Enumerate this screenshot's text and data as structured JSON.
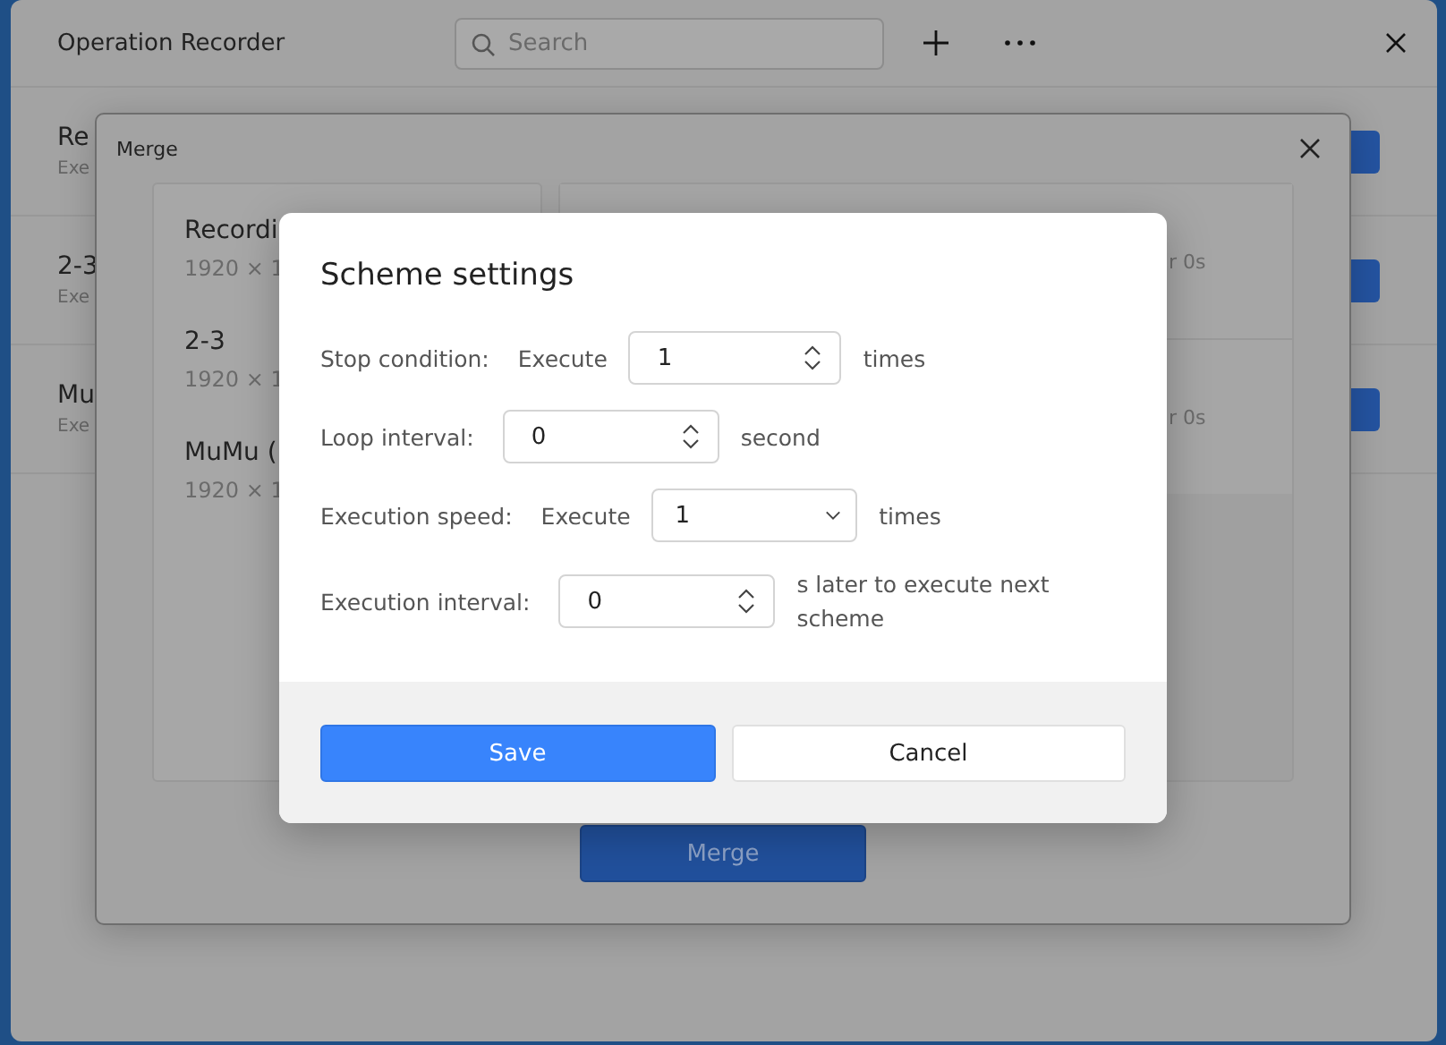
{
  "main_window": {
    "title": "Operation Recorder",
    "search": {
      "placeholder": "Search"
    },
    "rows": [
      {
        "name": "Re",
        "detail": "Exe"
      },
      {
        "name": "2-3",
        "detail": "Exe"
      },
      {
        "name": "Mu",
        "detail": "Exe"
      }
    ]
  },
  "merge_dialog": {
    "title": "Merge",
    "recordings": [
      {
        "name": "Recordi",
        "resolution": "1920 × 1"
      },
      {
        "name": "2-3",
        "resolution": "1920 × 1"
      },
      {
        "name": "MuMu (",
        "resolution": "1920 × 1"
      }
    ],
    "selected": [
      {
        "detail": "r 0s"
      },
      {
        "detail": "r 0s"
      }
    ],
    "merge_button": "Merge"
  },
  "scheme_dialog": {
    "title": "Scheme settings",
    "fields": [
      {
        "kind": "spin",
        "label": "Stop condition:",
        "prefix": "Execute",
        "value": "1",
        "suffix": "times"
      },
      {
        "kind": "spin",
        "label": "Loop interval:",
        "value": "0",
        "suffix": "second"
      },
      {
        "kind": "select",
        "label": "Execution speed:",
        "prefix": "Execute",
        "value": "1",
        "suffix": "times"
      },
      {
        "kind": "spin",
        "label": "Execution interval:",
        "value": "0",
        "suffix": "s later to execute next scheme"
      }
    ],
    "buttons": [
      {
        "kind": "primary",
        "label": "Save"
      },
      {
        "kind": "secondary",
        "label": "Cancel"
      }
    ]
  }
}
